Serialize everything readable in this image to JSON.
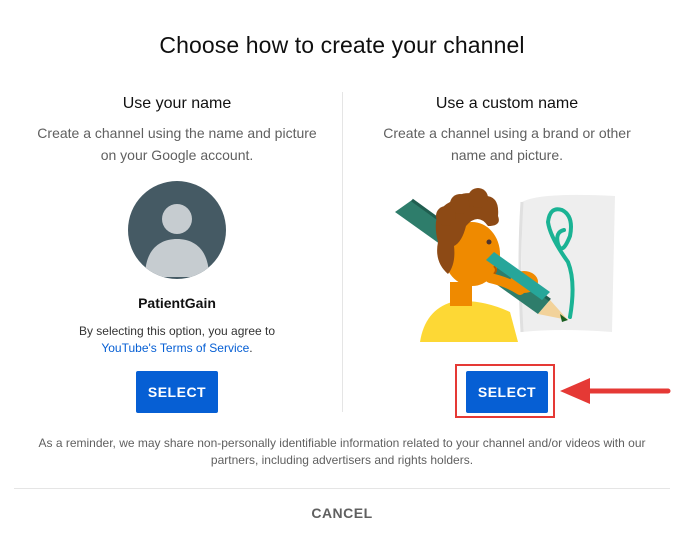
{
  "dialog": {
    "title": "Choose how to create your channel"
  },
  "left_option": {
    "heading": "Use your name",
    "description": "Create a channel using the name and picture on your Google account.",
    "account_name": "PatientGain",
    "agree_prefix": "By selecting this option, you agree to",
    "tos_link": "YouTube's Terms of Service",
    "tos_suffix": ".",
    "button_label": "SELECT",
    "avatar_icon": "default-avatar-icon"
  },
  "right_option": {
    "heading": "Use a custom name",
    "description": "Create a channel using a brand or other name and picture.",
    "button_label": "SELECT",
    "illustration_icon": "creator-drawing-illustration"
  },
  "reminder": "As a reminder, we may share non-personally identifiable information related to your channel and/or videos with our partners, including advertisers and rights holders.",
  "cancel_label": "CANCEL",
  "colors": {
    "primary_button": "#065fd4",
    "link": "#065fd4",
    "highlight": "#e53935",
    "avatar_bg": "#455a64"
  }
}
